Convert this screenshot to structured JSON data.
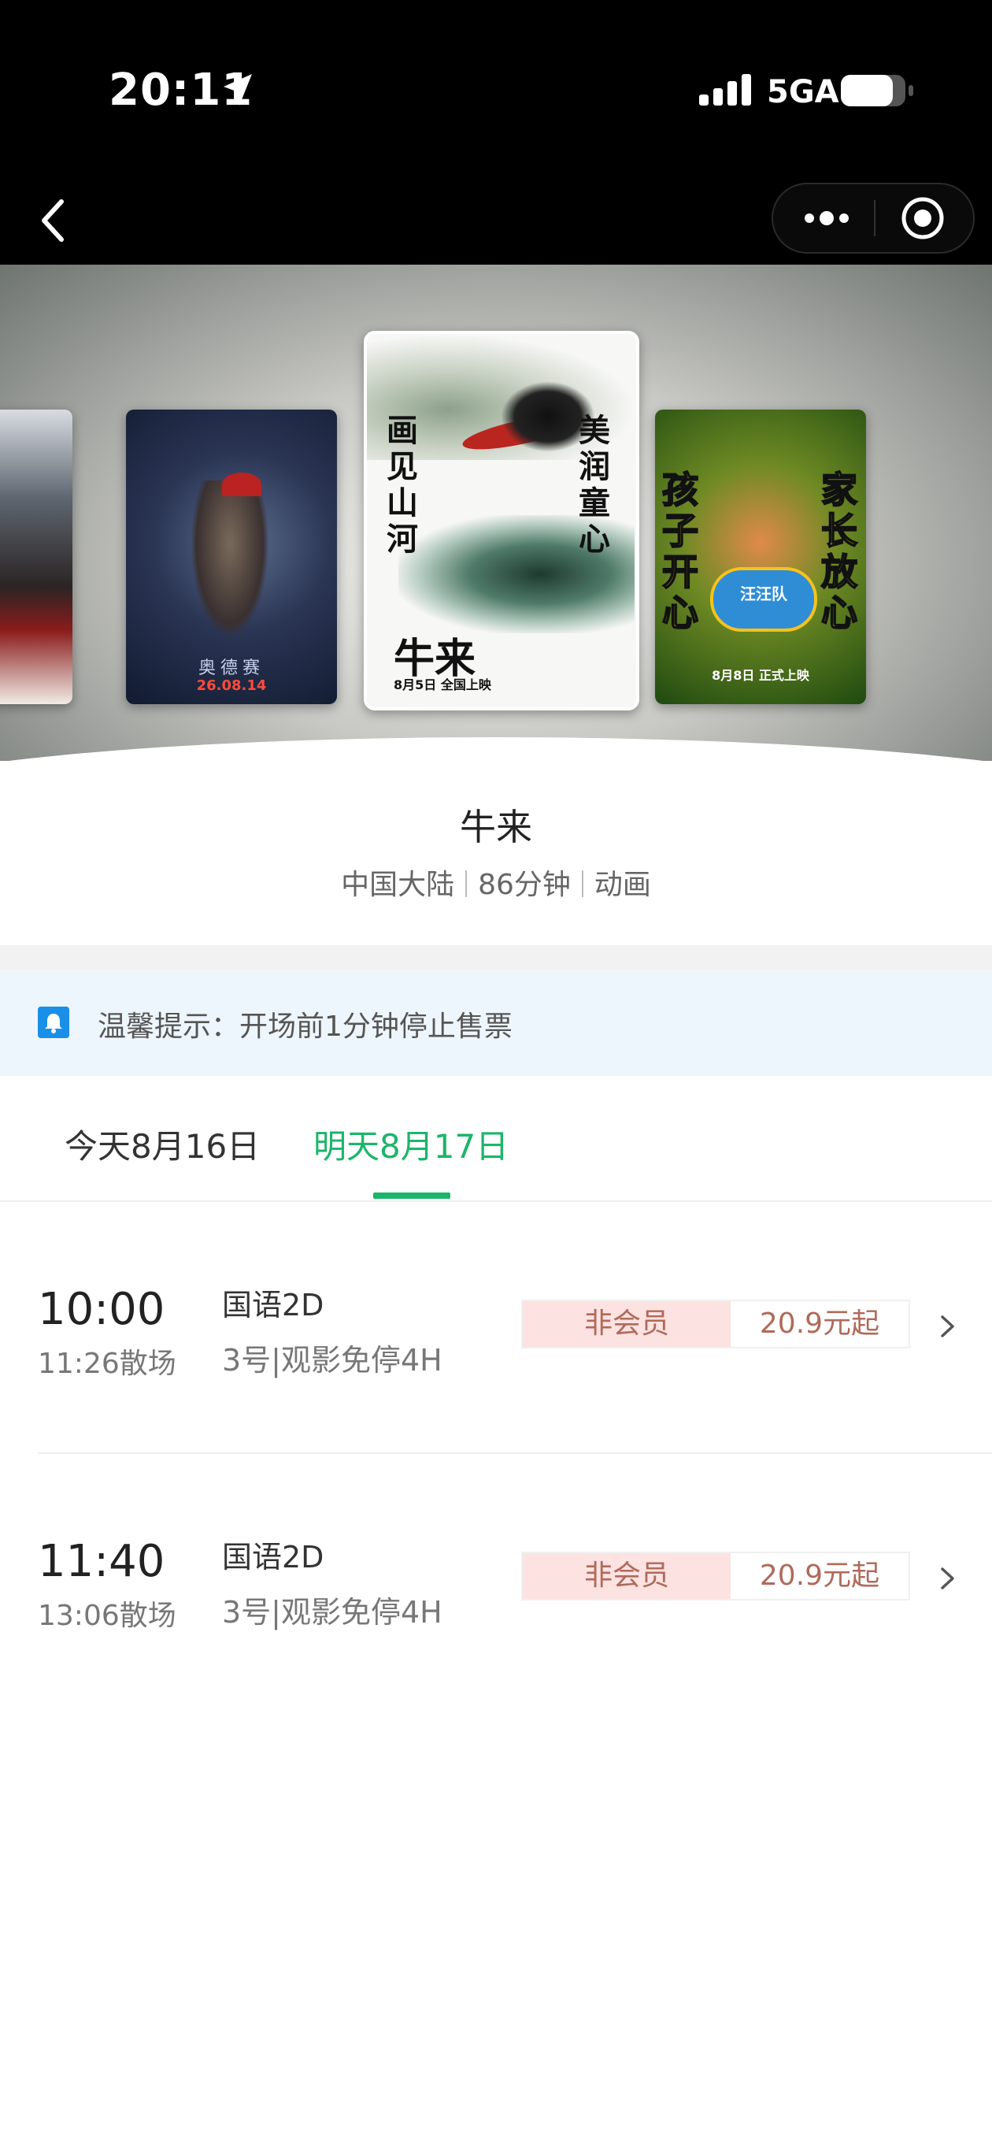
{
  "status_bar": {
    "time": "20:11",
    "network": "5GA",
    "icons": [
      "location-arrow-icon",
      "signal-bars-icon",
      "battery-icon"
    ]
  },
  "nav": {
    "icons": [
      "back-arrow-icon",
      "more-dots-icon",
      "close-target-icon"
    ]
  },
  "posters": [
    {
      "id": "p1",
      "text": ""
    },
    {
      "id": "p2",
      "title": "奥德赛",
      "date": "26.08.14"
    },
    {
      "id": "p3",
      "selected": true,
      "title": "牛来",
      "left_text": "画见山河",
      "right_text": "美润童心",
      "date": "8月5日 全国上映"
    },
    {
      "id": "p4",
      "left_text": "孩子开心",
      "right_text": "家长放心",
      "logo": "汪汪队",
      "date": "8月8日 正式上映"
    }
  ],
  "movie": {
    "title": "牛来",
    "region": "中国大陆",
    "duration": "86分钟",
    "genre": "动画"
  },
  "notice": {
    "icon": "bell-icon",
    "text": "温馨提示：开场前1分钟停止售票"
  },
  "date_tabs": [
    {
      "label": "今天8月16日",
      "active": false
    },
    {
      "label": "明天8月17日",
      "active": true
    }
  ],
  "showtimes": [
    {
      "start": "10:00",
      "end": "11:26散场",
      "language": "国语2D",
      "hall": "3号|观影免停4H",
      "member_tag": "非会员",
      "price": "20.9元起"
    },
    {
      "start": "11:40",
      "end": "13:06散场",
      "language": "国语2D",
      "hall": "3号|观影免停4H",
      "member_tag": "非会员",
      "price": "20.9元起"
    }
  ],
  "colors": {
    "accent_green": "#1cb56a",
    "notice_bg": "#eef6fd",
    "notice_icon": "#1a8fe8",
    "price_tag_bg": "#fde2e2",
    "price_text": "#b06a5a"
  }
}
